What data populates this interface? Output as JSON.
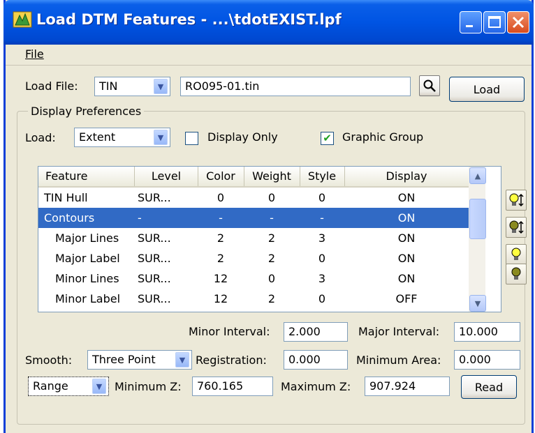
{
  "window": {
    "title": "Load DTM Features - ...\\tdotEXIST.lpf"
  },
  "menu": {
    "file": "File"
  },
  "load_file": {
    "label": "Load File:",
    "type_value": "TIN",
    "path_value": "RO095-01.tin",
    "load_button": "Load"
  },
  "display_prefs": {
    "title": "Display Preferences",
    "load_label": "Load:",
    "load_value": "Extent",
    "display_only_label": "Display Only",
    "display_only_checked": false,
    "graphic_group_label": "Graphic Group",
    "graphic_group_checked": true
  },
  "table": {
    "headers": [
      "Feature",
      "Level",
      "Color",
      "Weight",
      "Style",
      "Display"
    ],
    "rows": [
      {
        "feature": "TIN Hull",
        "level": "SUR...",
        "color": "0",
        "weight": "0",
        "style": "0",
        "display": "ON",
        "selected": false,
        "indent": false
      },
      {
        "feature": "Contours",
        "level": "-",
        "color": "-",
        "weight": "-",
        "style": "-",
        "display": "ON",
        "selected": true,
        "indent": false
      },
      {
        "feature": "Major Lines",
        "level": "SUR...",
        "color": "2",
        "weight": "2",
        "style": "3",
        "display": "ON",
        "selected": false,
        "indent": true
      },
      {
        "feature": "Major Label",
        "level": "SUR...",
        "color": "2",
        "weight": "2",
        "style": "0",
        "display": "ON",
        "selected": false,
        "indent": true
      },
      {
        "feature": "Minor Lines",
        "level": "SUR...",
        "color": "12",
        "weight": "0",
        "style": "3",
        "display": "ON",
        "selected": false,
        "indent": true
      },
      {
        "feature": "Minor Label",
        "level": "SUR...",
        "color": "12",
        "weight": "2",
        "style": "0",
        "display": "OFF",
        "selected": false,
        "indent": true
      }
    ]
  },
  "side_buttons": [
    "lightbulb-sort-on-icon",
    "lightbulb-sort-off-icon",
    "lightbulb-on-icon",
    "lightbulb-off-icon"
  ],
  "intervals": {
    "minor_label": "Minor Interval:",
    "minor_value": "2.000",
    "major_label": "Major Interval:",
    "major_value": "10.000"
  },
  "smooth": {
    "label": "Smooth:",
    "value": "Three Point",
    "registration_label": "Registration:",
    "registration_value": "0.000",
    "min_area_label": "Minimum Area:",
    "min_area_value": "0.000"
  },
  "range": {
    "mode_value": "Range",
    "min_z_label": "Minimum Z:",
    "min_z_value": "760.165",
    "max_z_label": "Maximum Z:",
    "max_z_value": "907.924",
    "read_button": "Read"
  },
  "colors": {
    "titlebar": "#0054e3",
    "selection": "#316ac5",
    "window_bg": "#ece9d8",
    "close_button": "#d84c1e"
  }
}
